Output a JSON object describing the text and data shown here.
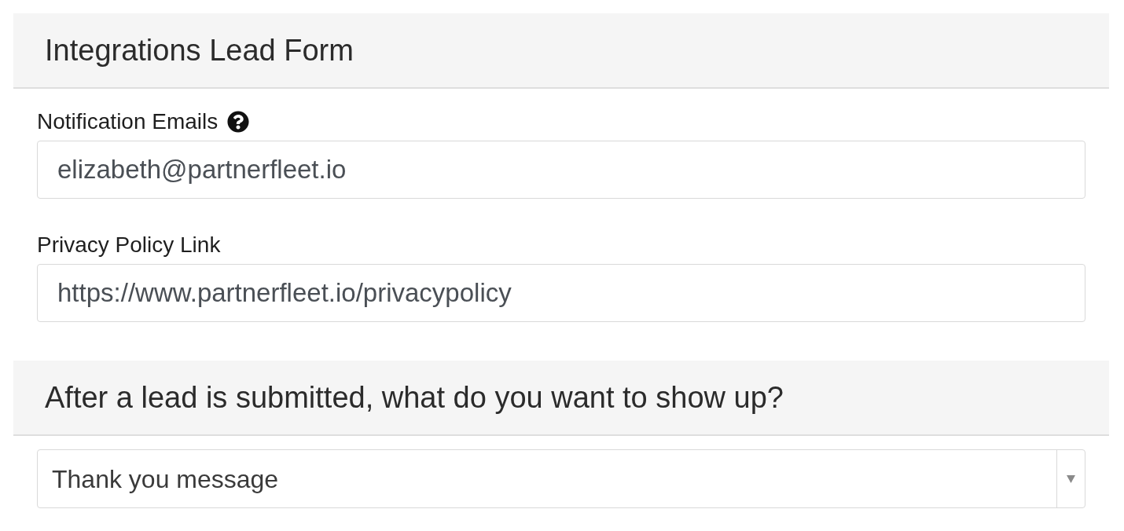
{
  "form_title": "Integrations Lead Form",
  "fields": [
    {
      "label": "Notification Emails",
      "help": true,
      "value": "elizabeth@partnerfleet.io"
    },
    {
      "label": "Privacy Policy Link",
      "help": false,
      "value": "https://www.partnerfleet.io/privacypolicy"
    }
  ],
  "section_title": "After a lead is submitted, what do you want to show up?",
  "select": {
    "value": "Thank you message"
  }
}
